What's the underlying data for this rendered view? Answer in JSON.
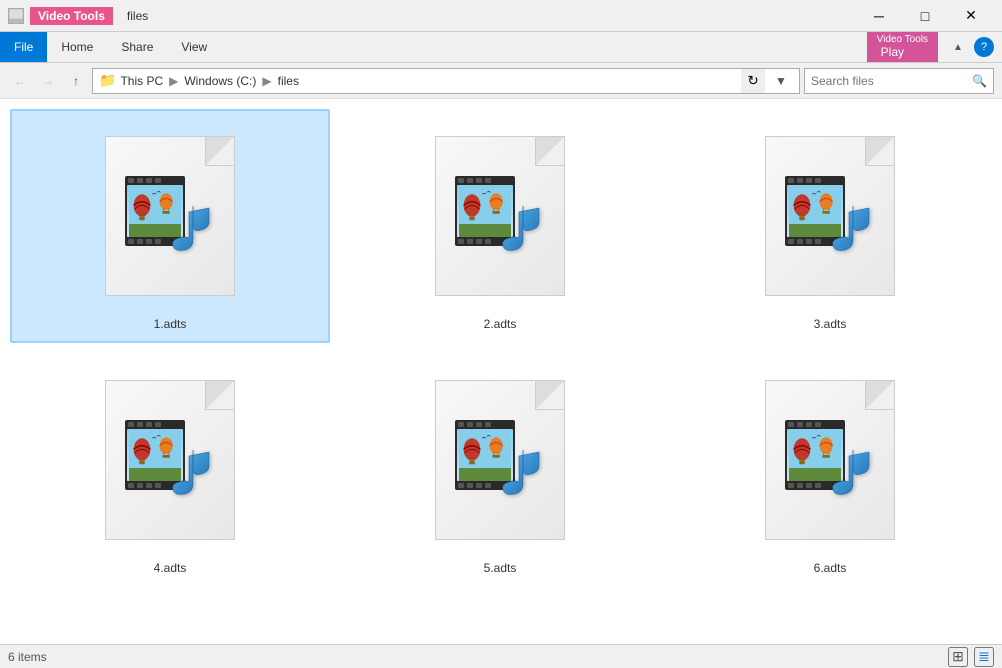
{
  "titleBar": {
    "appName": "files",
    "windowTitle": "Video Tools",
    "btnMin": "─",
    "btnMax": "□",
    "btnClose": "✕"
  },
  "ribbon": {
    "tabs": [
      {
        "id": "file",
        "label": "File",
        "active": false,
        "style": "blue"
      },
      {
        "id": "home",
        "label": "Home",
        "active": false,
        "style": "normal"
      },
      {
        "id": "share",
        "label": "Share",
        "active": false,
        "style": "normal"
      },
      {
        "id": "view",
        "label": "View",
        "active": false,
        "style": "normal"
      },
      {
        "id": "play",
        "label": "Play",
        "active": true,
        "style": "pink"
      },
      {
        "id": "videotools",
        "label": "Video Tools",
        "active": true,
        "style": "pink-label"
      }
    ]
  },
  "navBar": {
    "breadcrumbs": [
      "This PC",
      "Windows (C:)",
      "files"
    ],
    "searchPlaceholder": "Search files",
    "searchLabel": "Search"
  },
  "files": [
    {
      "id": 1,
      "name": "1.adts",
      "selected": true
    },
    {
      "id": 2,
      "name": "2.adts",
      "selected": false
    },
    {
      "id": 3,
      "name": "3.adts",
      "selected": false
    },
    {
      "id": 4,
      "name": "4.adts",
      "selected": false
    },
    {
      "id": 5,
      "name": "5.adts",
      "selected": false
    },
    {
      "id": 6,
      "name": "6.adts",
      "selected": false
    }
  ],
  "statusBar": {
    "itemCount": "6 items"
  }
}
